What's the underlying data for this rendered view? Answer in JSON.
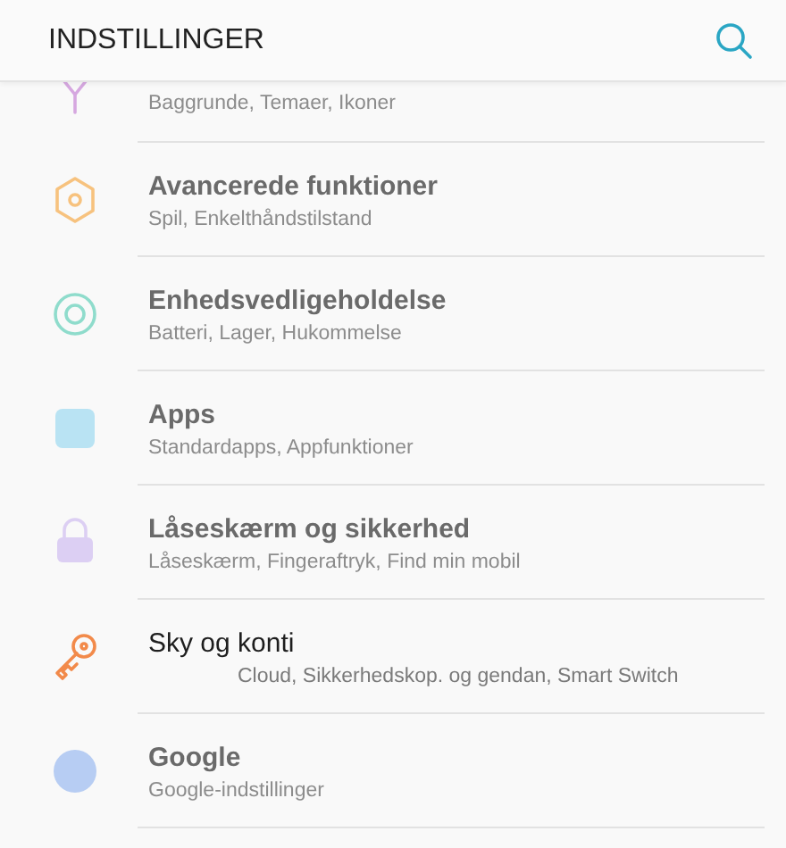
{
  "header": {
    "title": "INDSTILLINGER"
  },
  "items": [
    {
      "kind": "brush",
      "color": "#d6a8e0",
      "subtitle": "Baggrunde, Temaer, Ikoner",
      "blurred": true
    },
    {
      "kind": "gear",
      "color": "#f7c27e",
      "title": "Avancerede funktioner",
      "subtitle": "Spil, Enkelthåndstilstand",
      "blurred": true
    },
    {
      "kind": "maintenance",
      "color": "#8fdccc",
      "title": "Enhedsvedligeholdelse",
      "subtitle": "Batteri, Lager, Hukommelse",
      "blurred": true
    },
    {
      "kind": "apps",
      "color": "#b9e3f3",
      "title": "Apps",
      "subtitle": "Standardapps, Appfunktioner",
      "blurred": true
    },
    {
      "kind": "lock",
      "color": "#dccff3",
      "title": "Låseskærm og sikkerhed",
      "subtitle": "Låseskærm, Fingeraftryk, Find min mobil",
      "blurred": true
    },
    {
      "kind": "key",
      "color": "#f28a4a",
      "title": "Sky og konti",
      "subtitle": "Cloud, Sikkerhedskop. og gendan, Smart Switch",
      "blurred": false
    },
    {
      "kind": "google",
      "color": "#b7cdf3",
      "title": "Google",
      "subtitle": "Google-indstillinger",
      "blurred": true
    }
  ]
}
